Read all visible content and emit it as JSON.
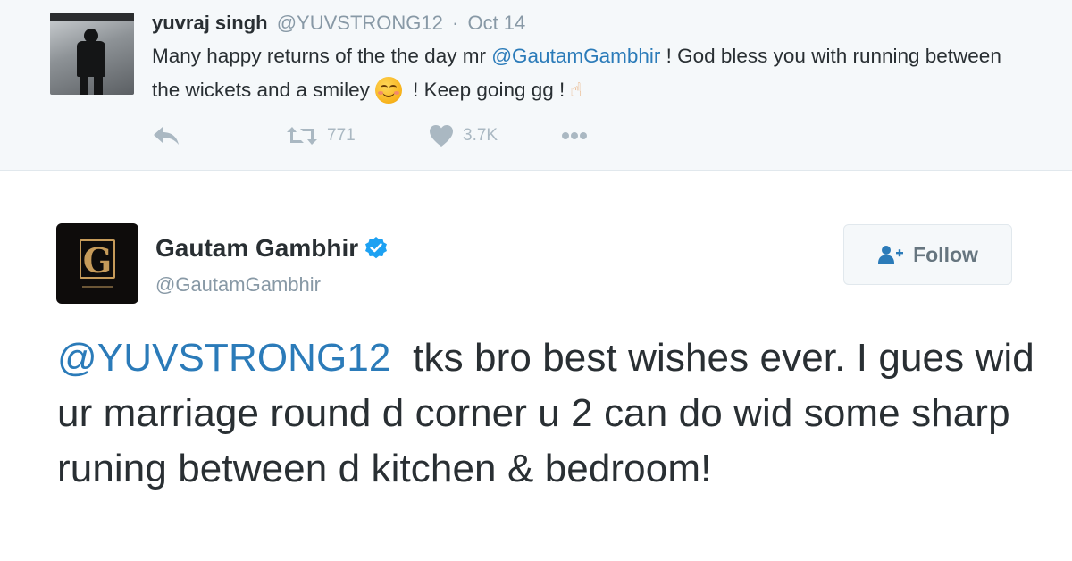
{
  "parent_tweet": {
    "name": "yuvraj singh",
    "handle": "@YUVSTRONG12",
    "separator": "·",
    "date": "Oct 14",
    "text_part1": "Many happy returns of the the day mr ",
    "mention": "@GautamGambhir",
    "text_part2": " ! God bless you with running between the wickets and a smiley",
    "text_part3": " ! Keep going gg !",
    "emoji_1": "smiling-face-with-smiling-eyes",
    "emoji_2": "pointing-hand",
    "retweet_count": "771",
    "like_count": "3.7K"
  },
  "main_tweet": {
    "name": "Gautam Gambhir",
    "verified": true,
    "handle": "@GautamGambhir",
    "follow_label": "Follow",
    "mention": "@YUVSTRONG12",
    "text": "  tks bro best wishes ever. I gues wid ur marriage round d corner u 2 can do wid some sharp runing between d kitchen & bedroom!"
  },
  "colors": {
    "link": "#2b7bb9",
    "verified": "#1da1f2",
    "muted": "#8899a6",
    "text": "#292f33"
  }
}
